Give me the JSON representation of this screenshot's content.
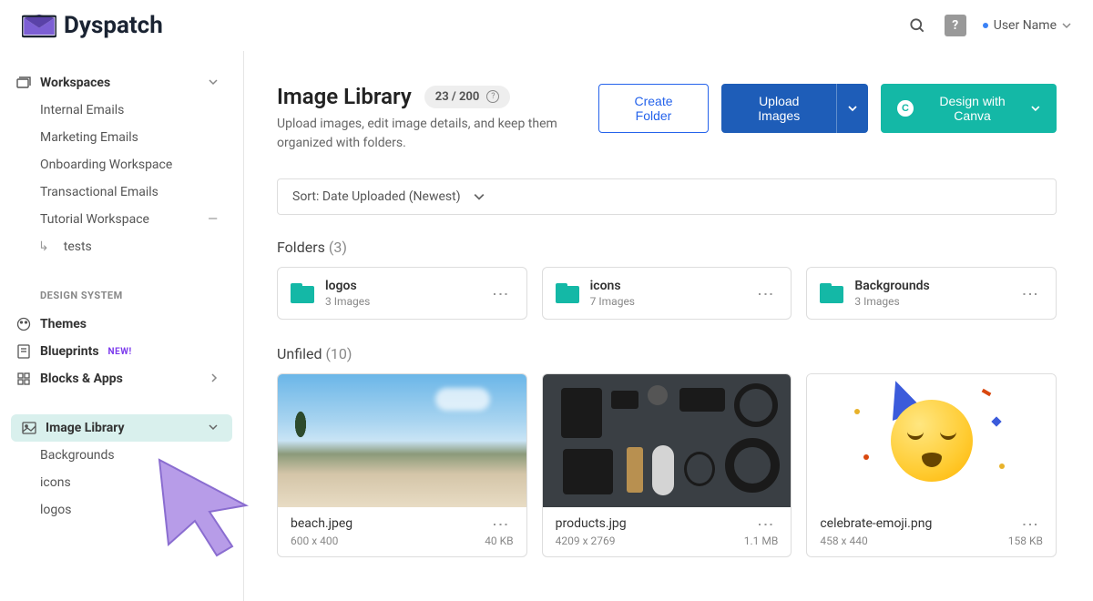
{
  "header": {
    "brand": "Dyspatch",
    "user_name": "User Name"
  },
  "sidebar": {
    "workspaces_label": "Workspaces",
    "workspaces": [
      "Internal Emails",
      "Marketing Emails",
      "Onboarding Workspace",
      "Transactional Emails",
      "Tutorial Workspace"
    ],
    "tutorial_children": [
      "tests"
    ],
    "design_system_heading": "DESIGN SYSTEM",
    "themes_label": "Themes",
    "blueprints_label": "Blueprints",
    "blueprints_badge": "NEW!",
    "blocks_label": "Blocks & Apps",
    "image_library_label": "Image Library",
    "image_library_children": [
      "Backgrounds",
      "icons",
      "logos"
    ]
  },
  "page": {
    "title": "Image Library",
    "count_badge": "23 / 200",
    "subtitle": "Upload images, edit image details, and keep them organized with folders.",
    "create_folder_btn": "Create Folder",
    "upload_btn": "Upload Images",
    "canva_btn": "Design with Canva",
    "sort_label": "Sort: Date Uploaded (Newest)"
  },
  "folders": {
    "heading": "Folders",
    "count": "(3)",
    "items": [
      {
        "name": "logos",
        "count": "3 Images"
      },
      {
        "name": "icons",
        "count": "7 Images"
      },
      {
        "name": "Backgrounds",
        "count": "3 Images"
      }
    ]
  },
  "unfiled": {
    "heading": "Unfiled",
    "count": "(10)",
    "items": [
      {
        "name": "beach.jpeg",
        "dims": "600 x 400",
        "size": "40 KB"
      },
      {
        "name": "products.jpg",
        "dims": "4209 x 2769",
        "size": "1.1 MB"
      },
      {
        "name": "celebrate-emoji.png",
        "dims": "458 x 440",
        "size": "158 KB"
      }
    ]
  }
}
